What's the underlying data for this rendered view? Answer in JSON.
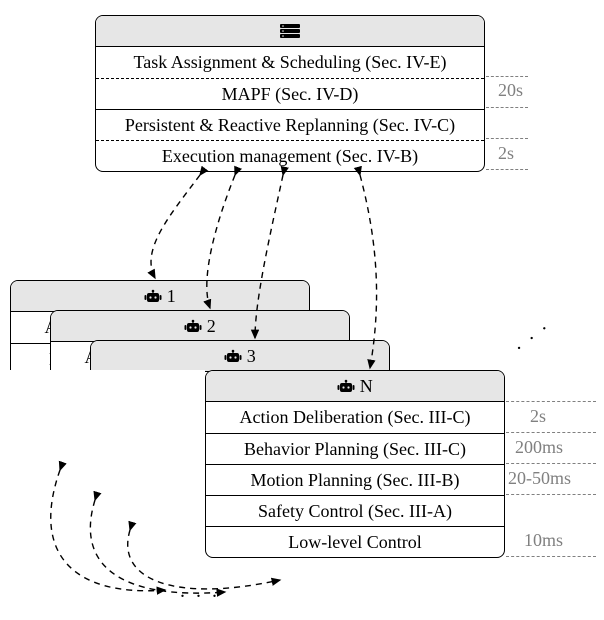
{
  "server": {
    "icon_name": "server-icon",
    "rows": [
      "Task Assignment & Scheduling (Sec. IV-E)",
      "MAPF (Sec. IV-D)",
      "Persistent & Reactive Replanning (Sec. IV-C)",
      "Execution management (Sec. IV-B)"
    ],
    "timings": {
      "upper": "20s",
      "lower": "2s"
    }
  },
  "robots": {
    "icon_name": "robot-icon",
    "labels": [
      "1",
      "2",
      "3",
      "N"
    ],
    "rows": [
      "Action Deliberation (Sec. III-C)",
      "Behavior Planning (Sec. III-C)",
      "Motion Planning (Sec. III-B)",
      "Safety Control (Sec. III-A)",
      "Low-level Control"
    ],
    "timings": {
      "r0": "2s",
      "r1": "200ms",
      "r2": "20-50ms",
      "r4": "10ms"
    }
  },
  "misc": {
    "ellipsis_right": ". . .",
    "ellipsis_bottom": ". . ."
  }
}
